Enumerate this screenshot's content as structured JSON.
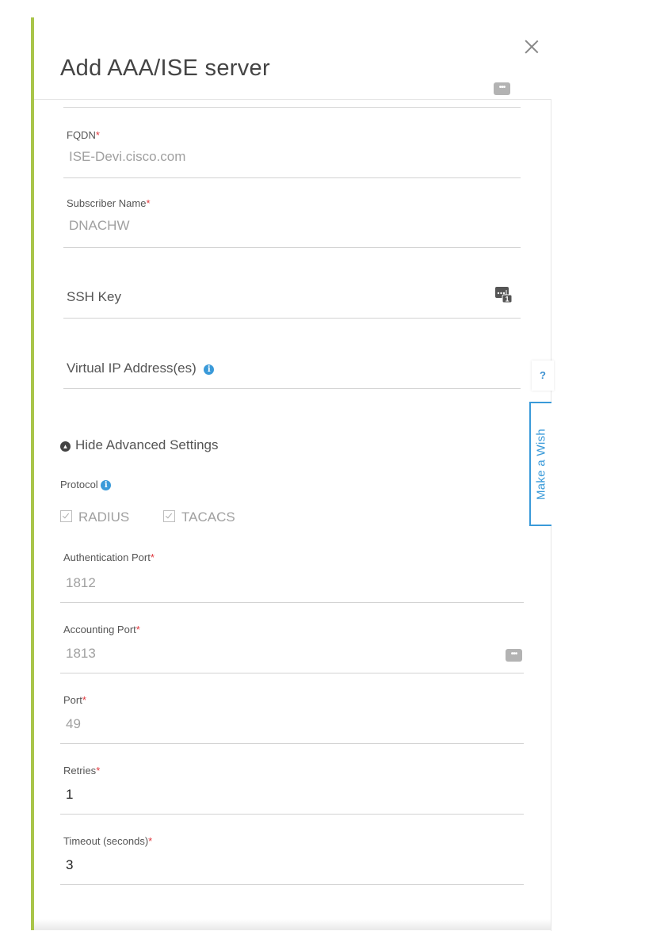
{
  "dialog": {
    "title": "Add AAA/ISE server",
    "close_icon": "close-icon",
    "more_icon": "more-dots-icon"
  },
  "fields": {
    "fqdn": {
      "label": "FQDN",
      "required_mark": "*",
      "value": "ISE-Devi.cisco.com"
    },
    "subscriber_name": {
      "label": "Subscriber Name",
      "required_mark": "*",
      "value": "DNACHW"
    },
    "ssh_key": {
      "placeholder": "SSH Key",
      "icon": "password-manager-icon",
      "badge": "1"
    },
    "virtual_ip": {
      "placeholder": "Virtual IP Address(es)",
      "info_icon": "info-icon"
    }
  },
  "advanced": {
    "toggle_label": "Hide Advanced Settings",
    "protocol_label": "Protocol",
    "protocols": [
      {
        "label": "RADIUS",
        "checked": true
      },
      {
        "label": "TACACS",
        "checked": true
      }
    ],
    "authentication_port": {
      "label": "Authentication Port",
      "required_mark": "*",
      "value": "1812"
    },
    "accounting_port": {
      "label": "Accounting Port",
      "required_mark": "*",
      "value": "1813"
    },
    "port": {
      "label": "Port",
      "required_mark": "*",
      "value": "49"
    },
    "retries": {
      "label": "Retries",
      "required_mark": "*",
      "value": "1"
    },
    "timeout": {
      "label": "Timeout (seconds)",
      "required_mark": "*",
      "value": "3"
    }
  },
  "side_tabs": {
    "help": "?",
    "wish": "Make a Wish"
  },
  "colors": {
    "accent": "#a9c54a",
    "link_blue": "#3a9ad9",
    "required": "#e0383e"
  }
}
